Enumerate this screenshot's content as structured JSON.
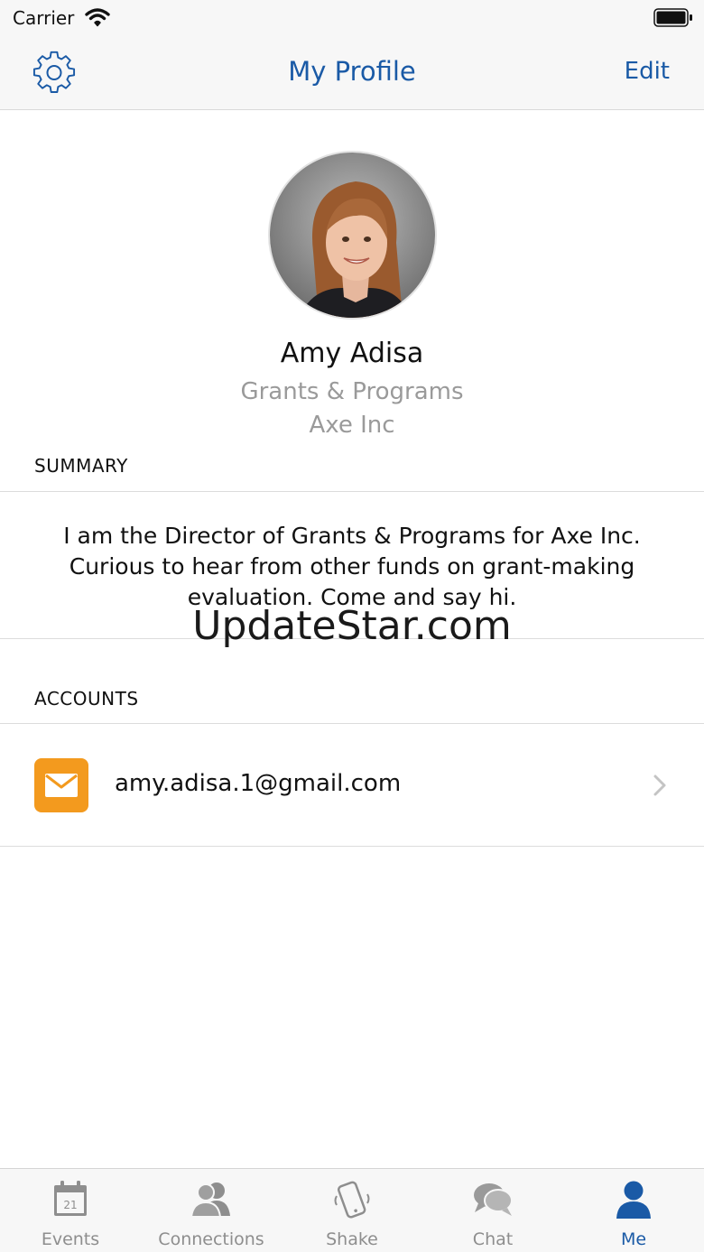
{
  "status_bar": {
    "carrier": "Carrier"
  },
  "nav": {
    "title": "My Profile",
    "edit_label": "Edit"
  },
  "profile": {
    "name": "Amy Adisa",
    "job_title": "Grants & Programs",
    "company": "Axe Inc"
  },
  "summary": {
    "header": "SUMMARY",
    "text": "I am the Director of Grants & Programs for Axe Inc. Curious to hear from other funds on grant-making evaluation. Come and say hi."
  },
  "watermark": "UpdateStar.com",
  "accounts": {
    "header": "ACCOUNTS",
    "items": [
      {
        "icon": "mail-icon",
        "email": "amy.adisa.1@gmail.com"
      }
    ]
  },
  "tabs": [
    {
      "label": "Events",
      "icon": "calendar-icon",
      "badge": "21"
    },
    {
      "label": "Connections",
      "icon": "people-icon"
    },
    {
      "label": "Shake",
      "icon": "shake-phone-icon"
    },
    {
      "label": "Chat",
      "icon": "chat-icon"
    },
    {
      "label": "Me",
      "icon": "person-icon",
      "active": true
    }
  ],
  "colors": {
    "accent": "#1a5aa6",
    "mail": "#f39a1e",
    "muted": "#9a9a9a"
  }
}
